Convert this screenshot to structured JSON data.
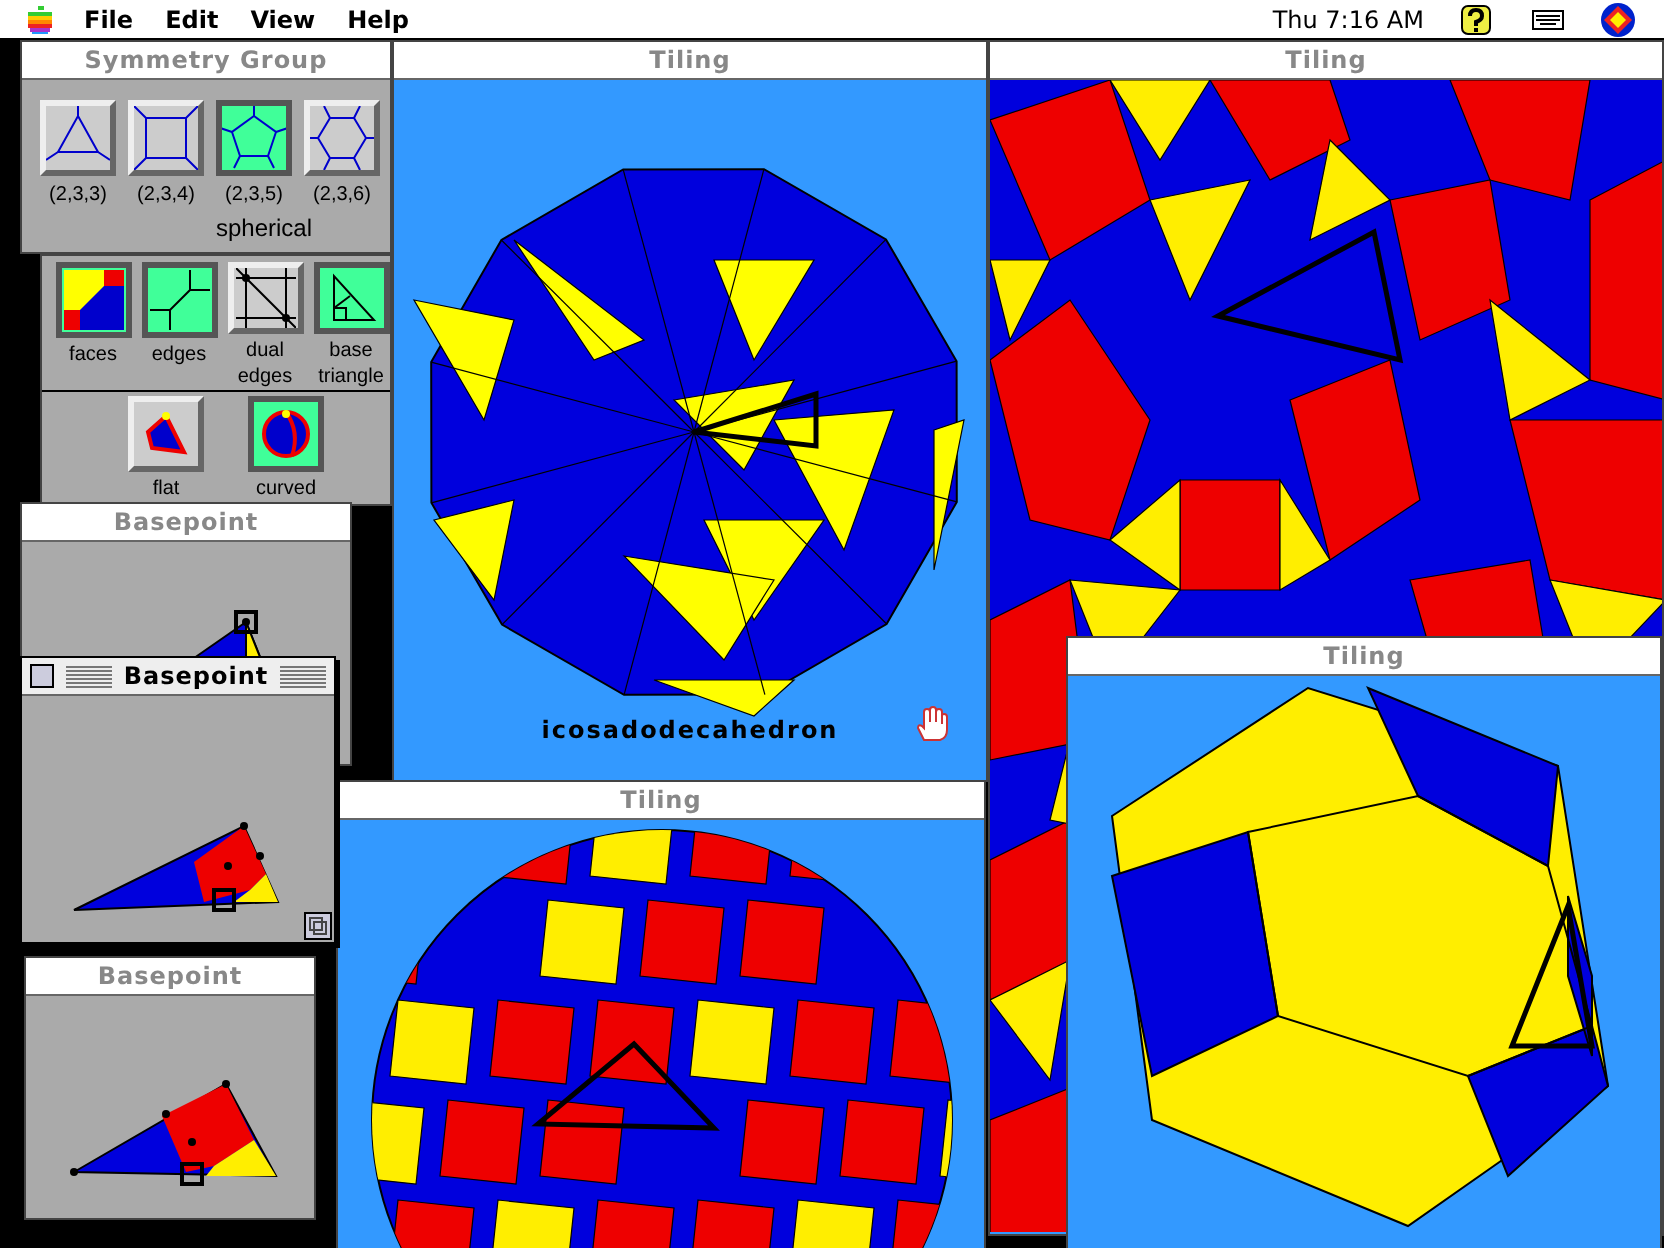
{
  "menu_bar": {
    "menus": [
      "File",
      "Edit",
      "View",
      "Help"
    ],
    "clock": "Thu 7:16 AM"
  },
  "symmetry_palette": {
    "title": "Symmetry Group",
    "groups": [
      {
        "label": "(2,3,3)",
        "kind": "triangle",
        "selected": false
      },
      {
        "label": "(2,3,4)",
        "kind": "square",
        "selected": false
      },
      {
        "label": "(2,3,5)",
        "kind": "pentagon",
        "selected": true
      },
      {
        "label": "(2,3,6)",
        "kind": "hexagon",
        "selected": false
      }
    ],
    "geometry": "spherical"
  },
  "display_palette": {
    "modes": [
      {
        "label": "faces",
        "kind": "faces",
        "selected": true
      },
      {
        "label": "edges",
        "kind": "edges",
        "selected": true
      },
      {
        "label": "dual edges",
        "kind": "dual",
        "selected": false
      },
      {
        "label": "base triangle",
        "kind": "triangle",
        "selected": true
      }
    ],
    "styles": [
      {
        "label": "flat",
        "kind": "flat",
        "selected": false
      },
      {
        "label": "curved",
        "kind": "curved",
        "selected": true
      }
    ]
  },
  "tiling_windows": [
    {
      "title": "Tiling",
      "kind": "polyhedron",
      "caption": "icosadodecahedron"
    },
    {
      "title": "Tiling",
      "kind": "plane"
    },
    {
      "title": "Tiling",
      "kind": "sphere"
    },
    {
      "title": "Tiling",
      "kind": "solid"
    }
  ],
  "basepoint_windows": [
    {
      "title": "Basepoint",
      "active": false
    },
    {
      "title": "Basepoint",
      "active": true
    },
    {
      "title": "Basepoint",
      "active": false
    }
  ]
}
